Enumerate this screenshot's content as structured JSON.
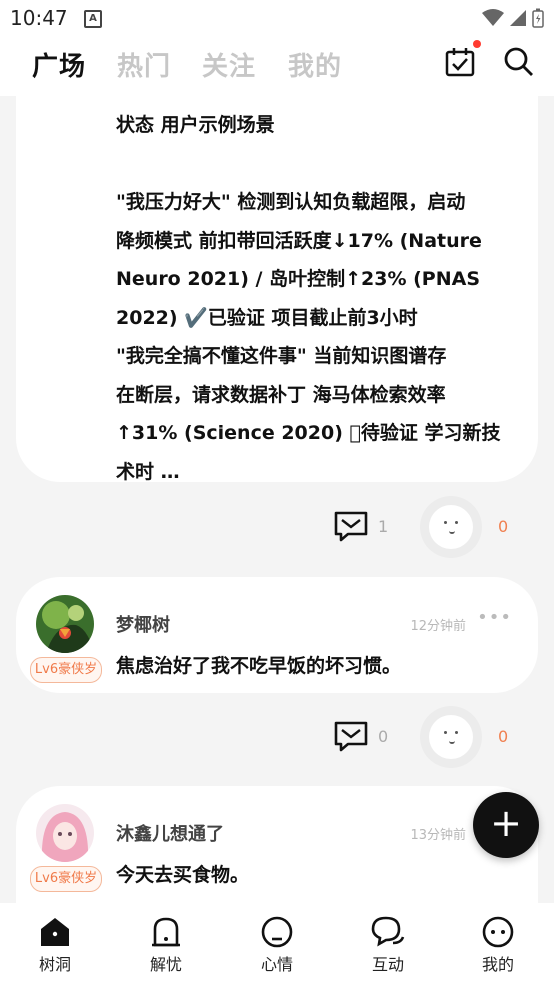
{
  "status_bar": {
    "time": "10:47",
    "app_badge": "A"
  },
  "tabs": [
    {
      "label": "广场",
      "active": true
    },
    {
      "label": "热门",
      "active": false
    },
    {
      "label": "关注",
      "active": false
    },
    {
      "label": "我的",
      "active": false
    }
  ],
  "card1": {
    "lines": [
      "状态  用户示例场景",
      "",
      " \"我压力好大\"  检测到认知负载超限，启动",
      "降频模式  前扣带回活跃度↓17% (Nature",
      "Neuro 2021) / 岛叶控制↑23% (PNAS",
      "2022)  ✔️已验证  项目截止前3小时",
      " \"我完全搞不懂这件事\"  当前知识图谱存",
      "在断层，请求数据补丁  海马体检索效率",
      "↑31% (Science 2020)  ⃞待验证  学习新技",
      "术时  …"
    ],
    "comment_count": "1",
    "hug_count": "0"
  },
  "posts": [
    {
      "username": "梦椰树",
      "badge": "Lv6豪侠岁",
      "time": "12分钟前",
      "content": "焦虑治好了我不吃早饭的坏习惯。",
      "comment_count": "0",
      "hug_count": "0"
    },
    {
      "username": "沐鑫儿想通了",
      "badge": "Lv6豪侠岁",
      "time": "13分钟前",
      "content": "今天去买食物。"
    }
  ],
  "bottom_nav": [
    {
      "label": "树洞",
      "icon": "home-icon",
      "active": true
    },
    {
      "label": "解忧",
      "icon": "bell-icon",
      "active": false
    },
    {
      "label": "心情",
      "icon": "mood-icon",
      "active": false
    },
    {
      "label": "互动",
      "icon": "chat-icon",
      "active": false
    },
    {
      "label": "我的",
      "icon": "profile-icon",
      "active": false
    }
  ],
  "colors": {
    "accent": "#f07a4a",
    "badge_red": "#ff3b30",
    "fab": "#111111"
  }
}
